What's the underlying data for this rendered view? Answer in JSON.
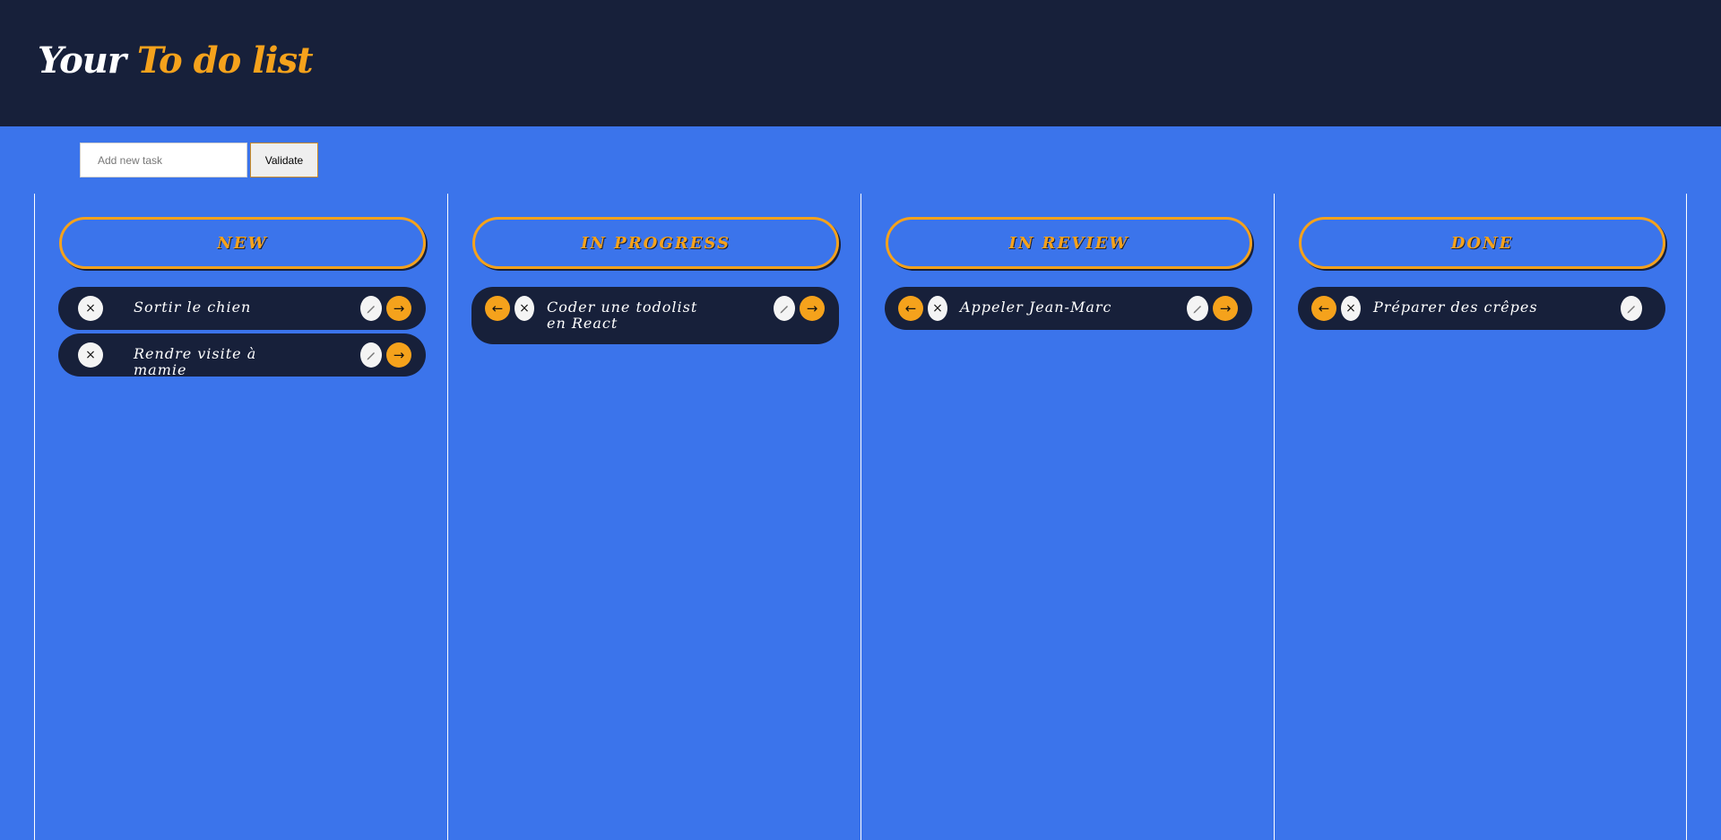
{
  "app": {
    "title_part1": "Your",
    "title_part2": "To do list"
  },
  "add_task": {
    "placeholder": "Add new task",
    "value": "",
    "validate_label": "Validate"
  },
  "icons": {
    "delete": "×",
    "prev": "←",
    "next": "→",
    "edit": "pencil-icon"
  },
  "colors": {
    "header_bg": "#17203a",
    "page_bg": "#3b74eb",
    "accent": "#f5a21c",
    "card_bg": "#17203a"
  },
  "columns": [
    {
      "title": "New",
      "tasks": [
        {
          "text": "Sortir le chien"
        },
        {
          "text": "Rendre visite à mamie"
        }
      ]
    },
    {
      "title": "In progress",
      "tasks": [
        {
          "text": "Coder une todolist en React"
        }
      ]
    },
    {
      "title": "In review",
      "tasks": [
        {
          "text": "Appeler Jean-Marc"
        }
      ]
    },
    {
      "title": "Done",
      "tasks": [
        {
          "text": "Préparer des crêpes"
        }
      ]
    }
  ]
}
